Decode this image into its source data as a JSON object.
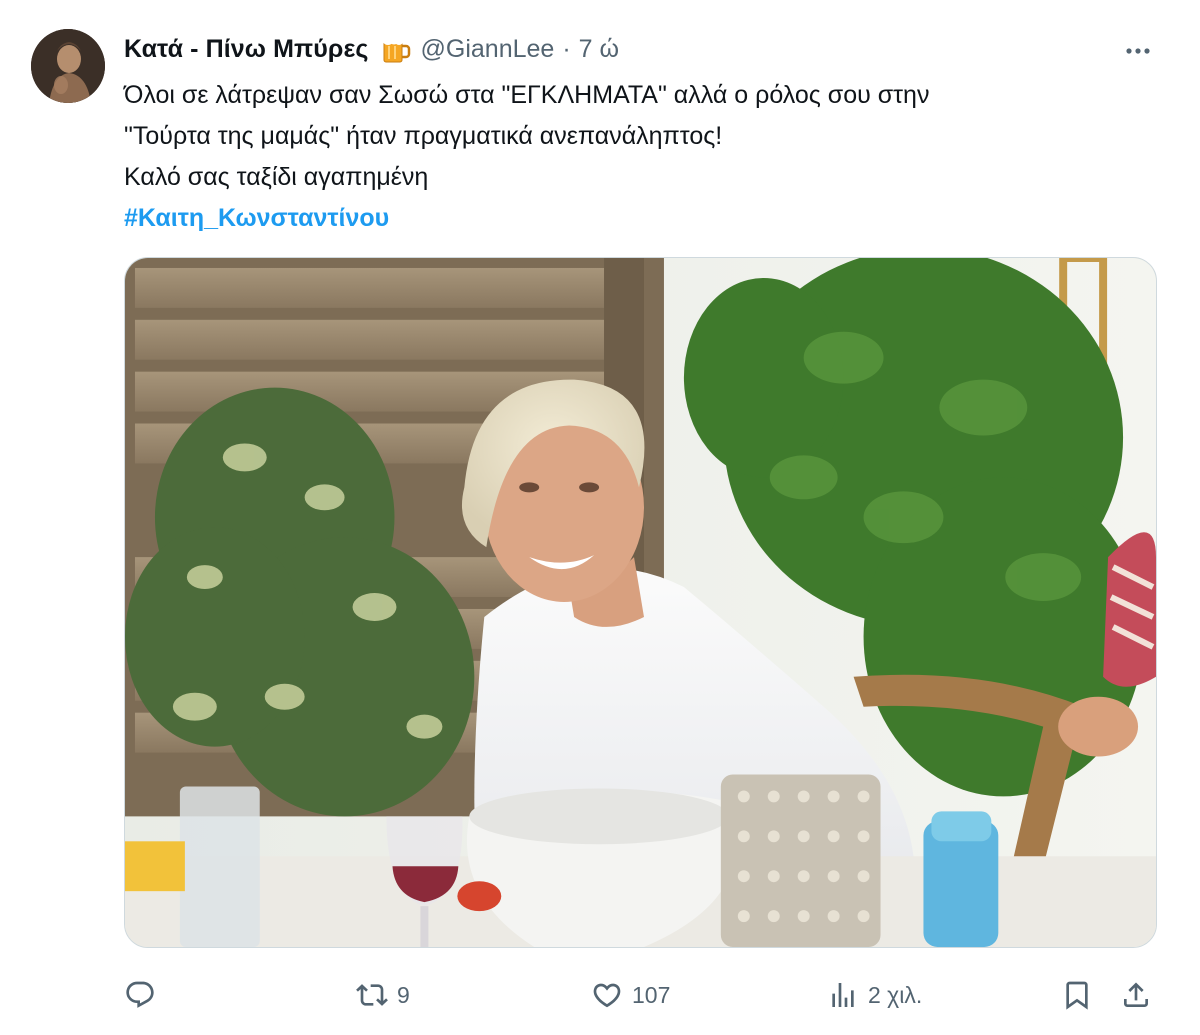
{
  "author": {
    "display_name": "Κατά - Πίνω Μπύρες",
    "handle": "@GiannLee",
    "separator": "·",
    "time": "7 ώ",
    "badge_icon": "beer-mug-emoji"
  },
  "tweet": {
    "lines": [
      "Όλοι σε λάτρεψαν σαν Σωσώ στα \"ΕΓΚΛΗΜΑΤΑ\" αλλά ο ρόλος σου στην",
      "\"Τούρτα της μαμάς\" ήταν πραγματικά ανεπανάληπτος!",
      "Καλό σας ταξίδι αγαπημένη"
    ],
    "hashtag": "#Καιτη_Κωνσταντίνου"
  },
  "actions": {
    "reply_count": "",
    "retweet_count": "9",
    "like_count": "107",
    "views_count": "2 χιλ."
  },
  "colors": {
    "accent": "#1d9bf0",
    "secondary_text": "#536471",
    "primary_text": "#0f1419"
  }
}
